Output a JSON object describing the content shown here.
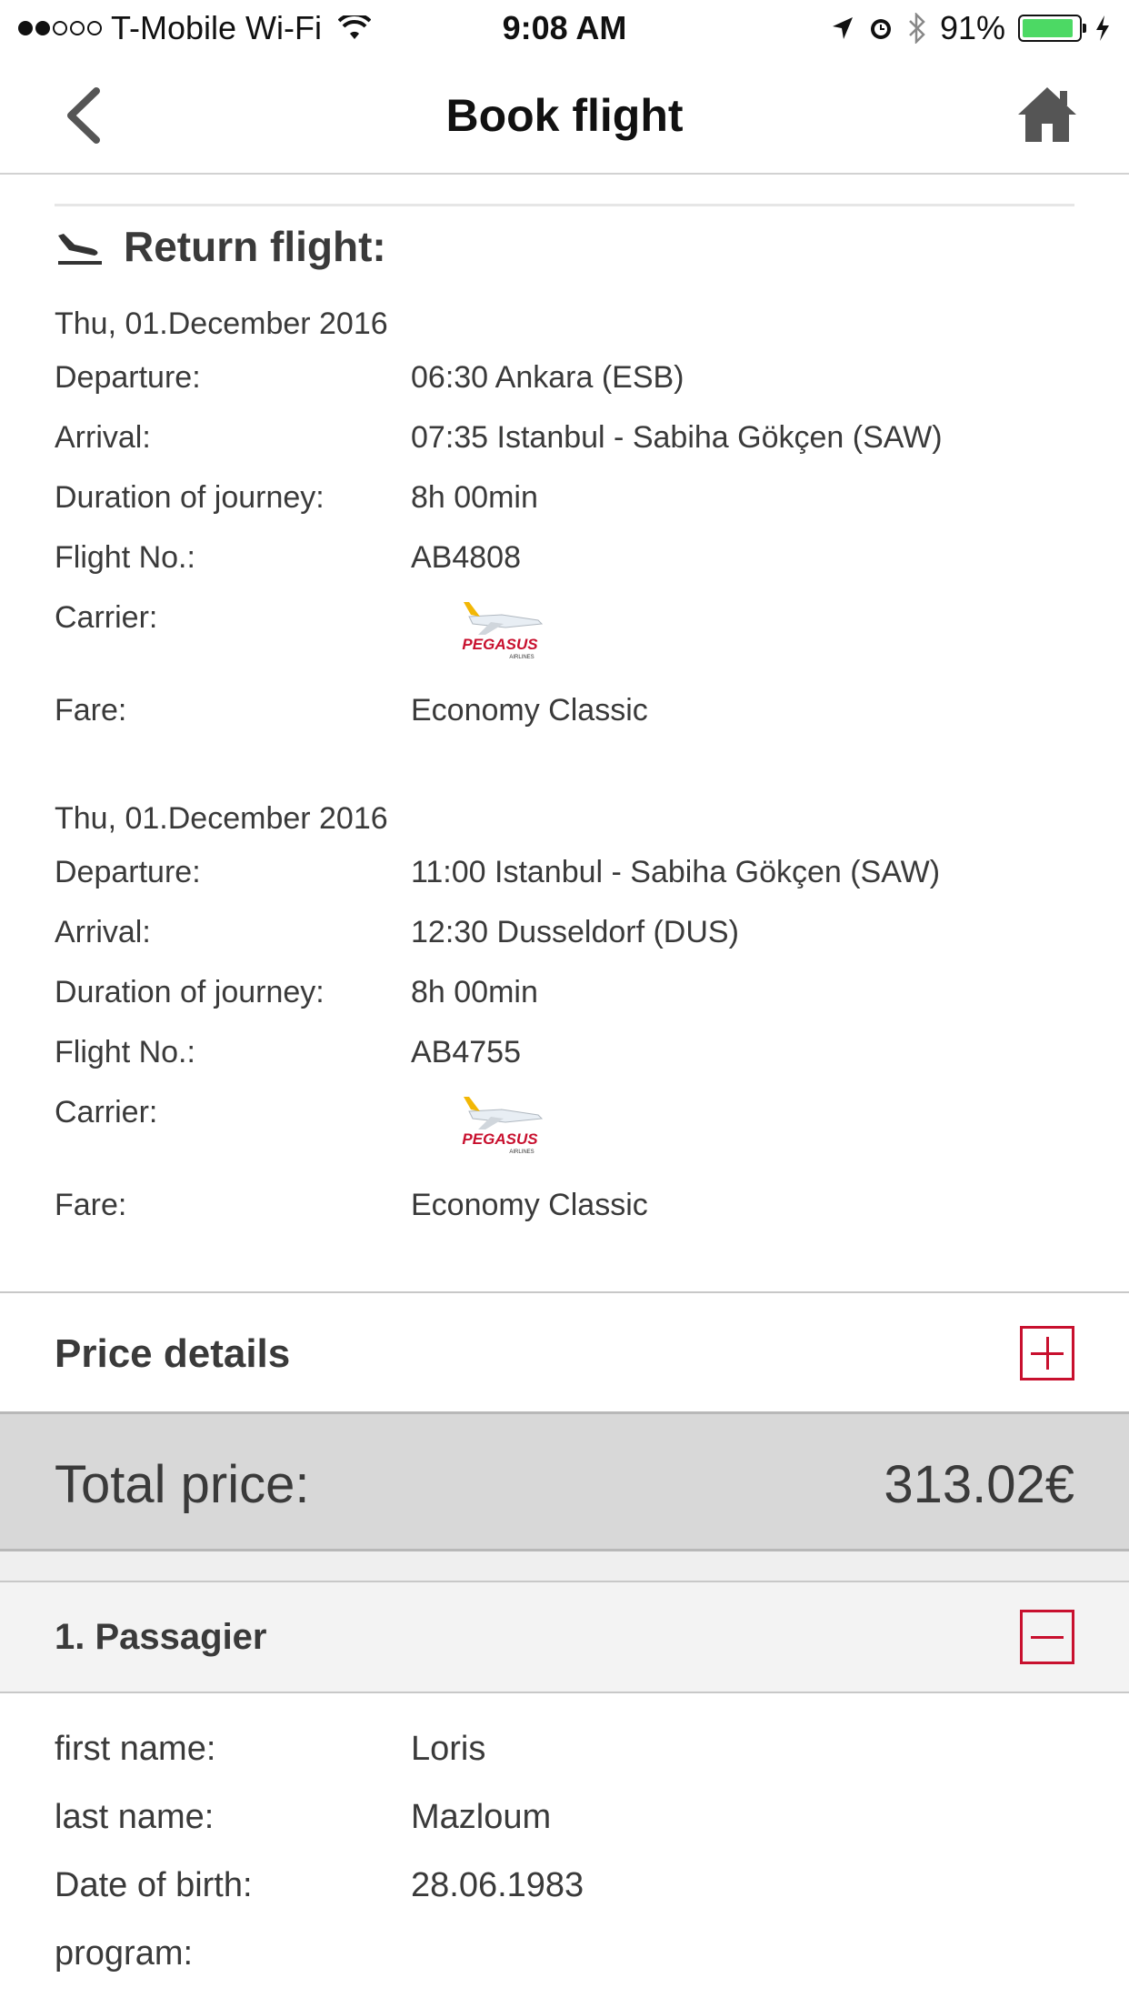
{
  "status_bar": {
    "carrier": "T-Mobile Wi-Fi",
    "time": "9:08 AM",
    "battery": "91%",
    "battery_level": 0.91,
    "signal_bars_filled": 2,
    "signal_bars_total": 5
  },
  "nav": {
    "title": "Book flight",
    "back_icon": "chevron-left-icon",
    "home_icon": "home-icon"
  },
  "section": {
    "title": "Return flight:",
    "icon": "plane-landing-icon"
  },
  "labels": {
    "departure": "Departure:",
    "arrival": "Arrival:",
    "duration": "Duration of journey:",
    "flight_no": "Flight No.:",
    "carrier": "Carrier:",
    "fare": "Fare:"
  },
  "flights": [
    {
      "date": "Thu, 01.December 2016",
      "departure": "06:30 Ankara (ESB)",
      "arrival": "07:35 Istanbul - Sabiha Gökçen (SAW)",
      "duration": "8h 00min",
      "flight_no": "AB4808",
      "carrier_logo_text": "PEGASUS",
      "carrier_logo_sub": "AIRLINES",
      "fare": "Economy Classic"
    },
    {
      "date": "Thu, 01.December 2016",
      "departure": "11:00 Istanbul - Sabiha Gökçen (SAW)",
      "arrival": "12:30 Dusseldorf (DUS)",
      "duration": "8h 00min",
      "flight_no": "AB4755",
      "carrier_logo_text": "PEGASUS",
      "carrier_logo_sub": "AIRLINES",
      "fare": "Economy Classic"
    }
  ],
  "price_details": {
    "title": "Price details",
    "toggle_icon": "plus-box-icon"
  },
  "total": {
    "label": "Total price:",
    "value": "313.02€"
  },
  "passenger": {
    "title": "1. Passagier",
    "toggle_icon": "minus-box-icon",
    "fields": [
      {
        "label": "first name:",
        "value": "Loris"
      },
      {
        "label": "last name:",
        "value": "Mazloum"
      },
      {
        "label": "Date of birth:",
        "value": "28.06.1983"
      },
      {
        "label": "program:",
        "value": ""
      }
    ]
  },
  "colors": {
    "accent_red": "#c8102e",
    "total_bg": "#d8d8d8",
    "battery_green": "#4cd964",
    "text": "#3a3a3a"
  }
}
